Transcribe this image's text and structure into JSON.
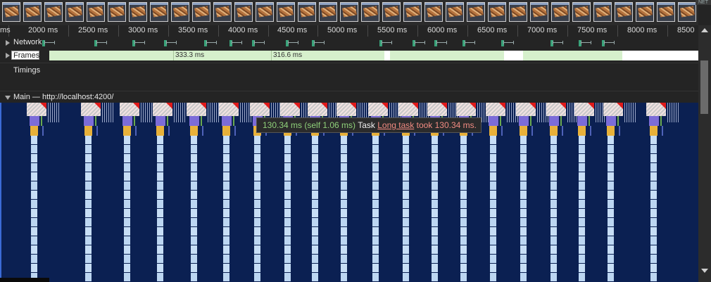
{
  "filmstrip": {
    "thumb_count": 33,
    "badge": "NET"
  },
  "ruler": {
    "ticks": [
      {
        "label": "ms"
      },
      {
        "label": "2000 ms"
      },
      {
        "label": "2500 ms"
      },
      {
        "label": "3000 ms"
      },
      {
        "label": "3500 ms"
      },
      {
        "label": "4000 ms"
      },
      {
        "label": "4500 ms"
      },
      {
        "label": "5000 ms"
      },
      {
        "label": "5500 ms"
      },
      {
        "label": "6000 ms"
      },
      {
        "label": "6500 ms"
      },
      {
        "label": "7000 ms"
      },
      {
        "label": "7500 ms"
      },
      {
        "label": "8000 ms"
      },
      {
        "label": "8500"
      }
    ]
  },
  "tracks": {
    "network_label": "Network",
    "frames_label": "Frames",
    "frame_durations": [
      "333.3 ms",
      "316.6 ms"
    ],
    "timings_label": "Timings",
    "main_label": "Main — http://localhost:4200/"
  },
  "tooltip": {
    "time": "130.34 ms (self 1.06 ms)",
    "name": "Task",
    "link": "Long task",
    "tail": "took 130.34 ms."
  },
  "colors": {
    "flame_bg": "#0b2052",
    "frame_green": "#d6f0cc",
    "task_red": "#e01a1a",
    "scripting_purple": "#7c6cd8",
    "function_yellow": "#e8b13a",
    "tooltip_time_green": "#8fd17a",
    "tooltip_warning_red": "#f28b82"
  },
  "icons": {
    "expand_network": "triangle-right-icon",
    "expand_frames": "triangle-right-icon",
    "collapse_main": "triangle-down-icon"
  }
}
